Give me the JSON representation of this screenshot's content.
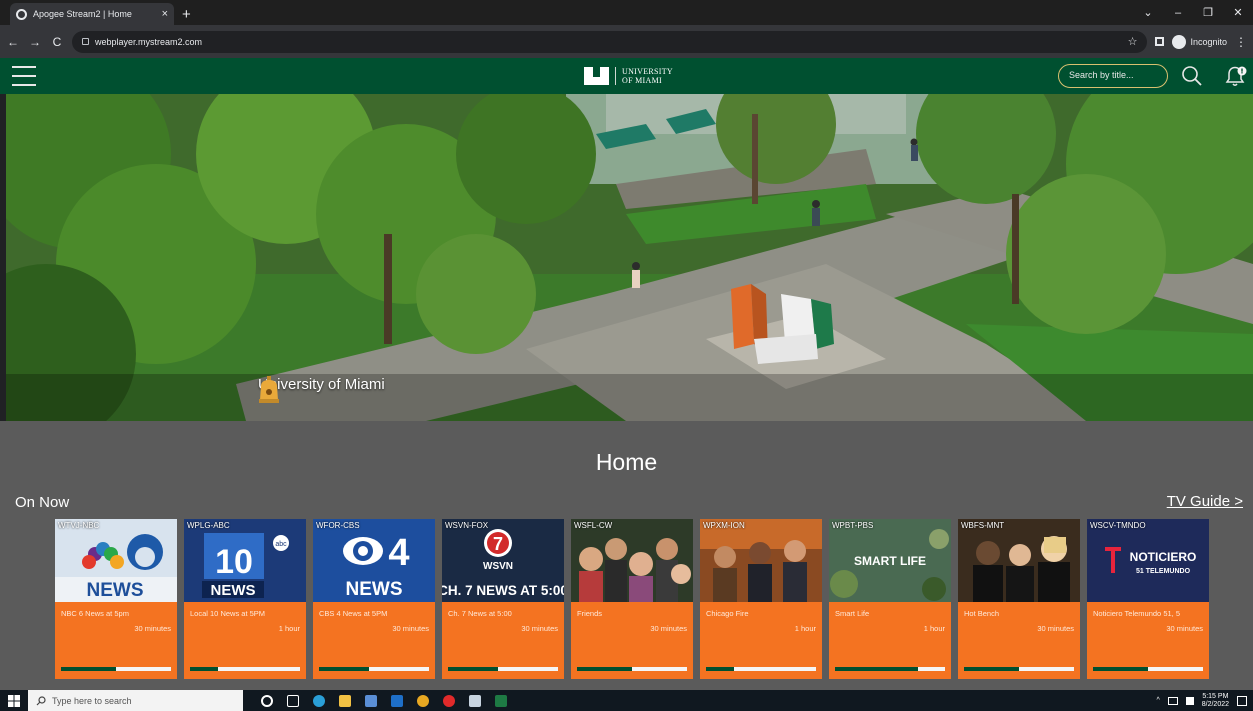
{
  "browser": {
    "tab_title": "Apogee Stream2 | Home",
    "tab_close": "×",
    "new_tab": "+",
    "url": "webplayer.mystream2.com",
    "incognito_label": "Incognito",
    "win_min": "‒",
    "win_restore": "❐",
    "win_close": "✕",
    "win_chevron": "⌄",
    "back": "←",
    "forward": "→",
    "reload": "C",
    "star": "☆",
    "menu": "⋮"
  },
  "header": {
    "logo_line1": "UNIVERSITY",
    "logo_line2": "OF MIAMI",
    "search_placeholder": "Search by title...",
    "icons": {
      "menu": "hamburger-icon",
      "search": "search-icon",
      "notifications": "bell-icon"
    }
  },
  "hero": {
    "caption": "University of Miami"
  },
  "main": {
    "title": "Home",
    "section_label": "On Now",
    "tv_guide_link": "TV Guide >"
  },
  "channels": [
    {
      "call": "WTVJ-NBC",
      "program": "NBC 6 News at 5pm",
      "duration": "30 minutes",
      "progress": 0.5,
      "thumb_text": "NEWS",
      "thumb_big": "6"
    },
    {
      "call": "WPLG-ABC",
      "program": "Local 10 News at 5PM",
      "duration": "1 hour",
      "progress": 0.25,
      "thumb_text": "NEWS",
      "thumb_big": "10",
      "thumb_extra": "abc"
    },
    {
      "call": "WFOR-CBS",
      "program": "CBS 4 News at 5PM",
      "duration": "30 minutes",
      "progress": 0.45,
      "thumb_text": "NEWS",
      "thumb_big": "4"
    },
    {
      "call": "WSVN-FOX",
      "program": "Ch. 7 News at 5:00",
      "duration": "30 minutes",
      "progress": 0.45,
      "thumb_text": "CH. 7 NEWS AT 5:00",
      "thumb_big": "7",
      "thumb_extra": "WSVN"
    },
    {
      "call": "WSFL-CW",
      "program": "Friends",
      "duration": "30 minutes",
      "progress": 0.5,
      "thumb_text": ""
    },
    {
      "call": "WPXM-ION",
      "program": "Chicago Fire",
      "duration": "1 hour",
      "progress": 0.25,
      "thumb_text": ""
    },
    {
      "call": "WPBT-PBS",
      "program": "Smart Life",
      "duration": "1 hour",
      "progress": 0.75,
      "thumb_text": "SMART LIFE"
    },
    {
      "call": "WBFS-MNT",
      "program": "Hot Bench",
      "duration": "30 minutes",
      "progress": 0.5,
      "thumb_text": ""
    },
    {
      "call": "WSCV-TMNDO",
      "program": "Noticiero Telemundo 51, 5",
      "duration": "30 minutes",
      "progress": 0.5,
      "thumb_text": "NOTICIERO",
      "thumb_sub": "51 TELEMUNDO"
    }
  ],
  "taskbar": {
    "search_placeholder": "Type here to search",
    "time": "5:15 PM",
    "date": "8/2/2022"
  },
  "colors": {
    "brand_green": "#005030",
    "brand_orange": "#f47321",
    "content_bg": "#5b5b5b"
  }
}
